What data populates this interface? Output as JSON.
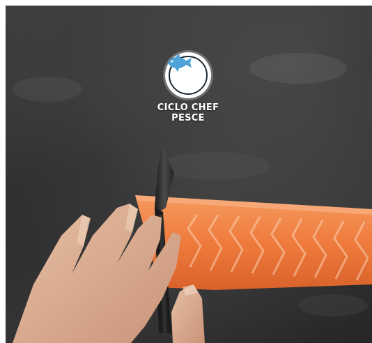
{
  "logo": {
    "icon": "fish-icon",
    "line1": "CICLO CHEF",
    "line2": "PESCE",
    "icon_color": "#4fa3d9"
  },
  "colors": {
    "background": "#2f2f2f",
    "salmon": "#f07a3c"
  }
}
